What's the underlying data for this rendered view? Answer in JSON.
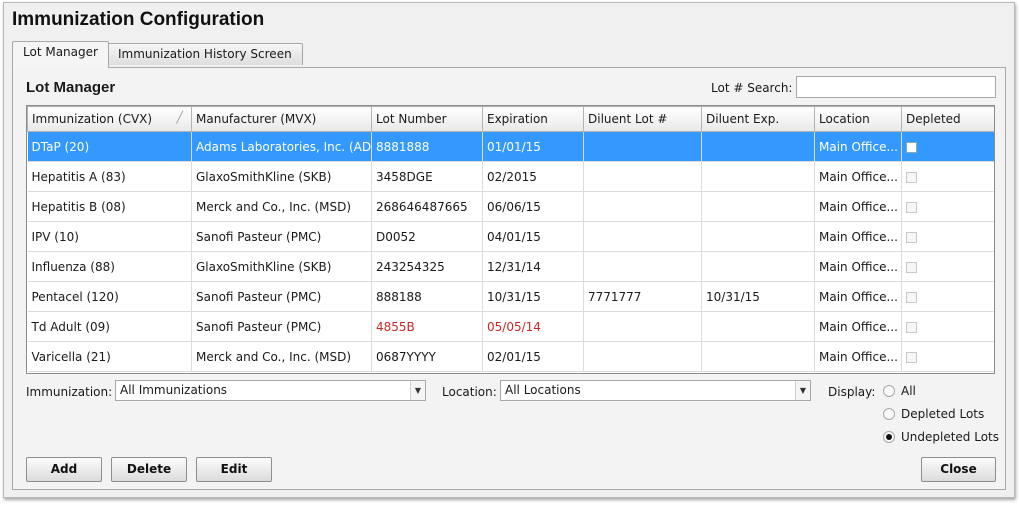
{
  "window": {
    "title": "Immunization Configuration"
  },
  "tabs": [
    {
      "label": "Lot Manager",
      "active": true
    },
    {
      "label": "Immunization History Screen",
      "active": false
    }
  ],
  "lot_manager": {
    "section_title": "Lot Manager",
    "search": {
      "label": "Lot # Search:",
      "value": "",
      "placeholder": ""
    },
    "columns": [
      "Immunization (CVX)",
      "Manufacturer (MVX)",
      "Lot Number",
      "Expiration",
      "Diluent Lot #",
      "Diluent Exp.",
      "Location",
      "Depleted"
    ],
    "rows": [
      {
        "immunization": "DTaP (20)",
        "manufacturer": "Adams Laboratories, Inc. (AD)",
        "lot": "8881888",
        "expiration": "01/01/15",
        "diluent_lot": "",
        "diluent_exp": "",
        "location": "Main Office...",
        "selected": true,
        "expired": false
      },
      {
        "immunization": "Hepatitis A (83)",
        "manufacturer": "GlaxoSmithKline (SKB)",
        "lot": "3458DGE",
        "expiration": "02/2015",
        "diluent_lot": "",
        "diluent_exp": "",
        "location": "Main Office...",
        "selected": false,
        "expired": false
      },
      {
        "immunization": "Hepatitis B (08)",
        "manufacturer": "Merck and Co., Inc. (MSD)",
        "lot": "268646487665",
        "expiration": "06/06/15",
        "diluent_lot": "",
        "diluent_exp": "",
        "location": "Main Office...",
        "selected": false,
        "expired": false
      },
      {
        "immunization": "IPV (10)",
        "manufacturer": "Sanofi Pasteur (PMC)",
        "lot": "D0052",
        "expiration": "04/01/15",
        "diluent_lot": "",
        "diluent_exp": "",
        "location": "Main Office...",
        "selected": false,
        "expired": false
      },
      {
        "immunization": "Influenza (88)",
        "manufacturer": "GlaxoSmithKline (SKB)",
        "lot": "243254325",
        "expiration": "12/31/14",
        "diluent_lot": "",
        "diluent_exp": "",
        "location": "Main Office...",
        "selected": false,
        "expired": false
      },
      {
        "immunization": "Pentacel (120)",
        "manufacturer": "Sanofi Pasteur (PMC)",
        "lot": "888188",
        "expiration": "10/31/15",
        "diluent_lot": "7771777",
        "diluent_exp": "10/31/15",
        "location": "Main Office...",
        "selected": false,
        "expired": false
      },
      {
        "immunization": "Td Adult (09)",
        "manufacturer": "Sanofi Pasteur (PMC)",
        "lot": "4855B",
        "expiration": "05/05/14",
        "diluent_lot": "",
        "diluent_exp": "",
        "location": "Main Office...",
        "selected": false,
        "expired": true
      },
      {
        "immunization": "Varicella (21)",
        "manufacturer": "Merck and Co., Inc. (MSD)",
        "lot": "0687YYYY",
        "expiration": "02/01/15",
        "diluent_lot": "",
        "diluent_exp": "",
        "location": "Main Office...",
        "selected": false,
        "expired": false
      }
    ]
  },
  "filters": {
    "immunization": {
      "label": "Immunization:",
      "value": "All Immunizations"
    },
    "location": {
      "label": "Location:",
      "value": "All Locations"
    },
    "display": {
      "label": "Display:",
      "options": [
        {
          "label": "All",
          "checked": false
        },
        {
          "label": "Depleted Lots",
          "checked": false
        },
        {
          "label": "Undepleted Lots",
          "checked": true
        }
      ]
    }
  },
  "buttons": {
    "add": "Add",
    "delete": "Delete",
    "edit": "Edit",
    "close": "Close"
  },
  "colors": {
    "selection": "#3399ff",
    "expired_text": "#c62828"
  }
}
